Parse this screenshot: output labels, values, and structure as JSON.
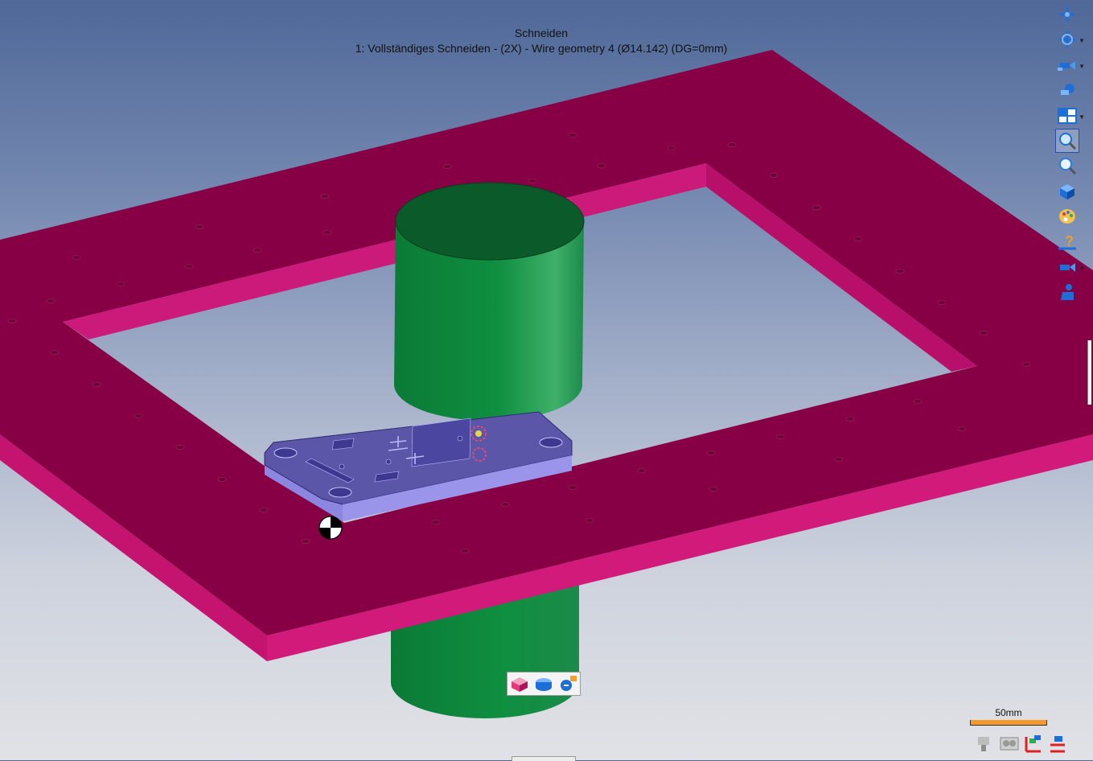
{
  "header": {
    "title": "Schneiden",
    "subtitle": "1: Vollständiges Schneiden - (2X) - Wire geometry 4 (Ø14.142) (DG=0mm)"
  },
  "colors": {
    "frame_top": "#870046",
    "frame_inner_edge": "#cc1a7a",
    "frame_front_edge": "#c4146f",
    "cylinder": "#0e8a3e",
    "cylinder_top": "#0b5a2a",
    "plate_top": "#5b56a8",
    "plate_side": "#8b86e0",
    "scale_bar": "#f39a2a"
  },
  "toolbar": {
    "items": [
      {
        "name": "axis-plus",
        "has_dropdown": false
      },
      {
        "name": "rotate-view",
        "has_dropdown": true
      },
      {
        "name": "camera-view",
        "has_dropdown": true
      },
      {
        "name": "camera-pan",
        "has_dropdown": false
      },
      {
        "name": "viewport-layout",
        "has_dropdown": true
      },
      {
        "name": "zoom-window",
        "has_dropdown": false,
        "active": true
      },
      {
        "name": "zoom",
        "has_dropdown": false
      },
      {
        "name": "view-cube",
        "has_dropdown": false
      },
      {
        "name": "color-palette",
        "has_dropdown": false
      },
      {
        "name": "help",
        "has_dropdown": false
      },
      {
        "name": "camera-settings",
        "has_dropdown": true
      },
      {
        "name": "machine-user",
        "has_dropdown": false
      }
    ]
  },
  "scale": {
    "label": "50mm"
  },
  "mini_toolbar": {
    "items": [
      "stock-model-icon",
      "part-model-icon",
      "simulation-icon"
    ]
  }
}
